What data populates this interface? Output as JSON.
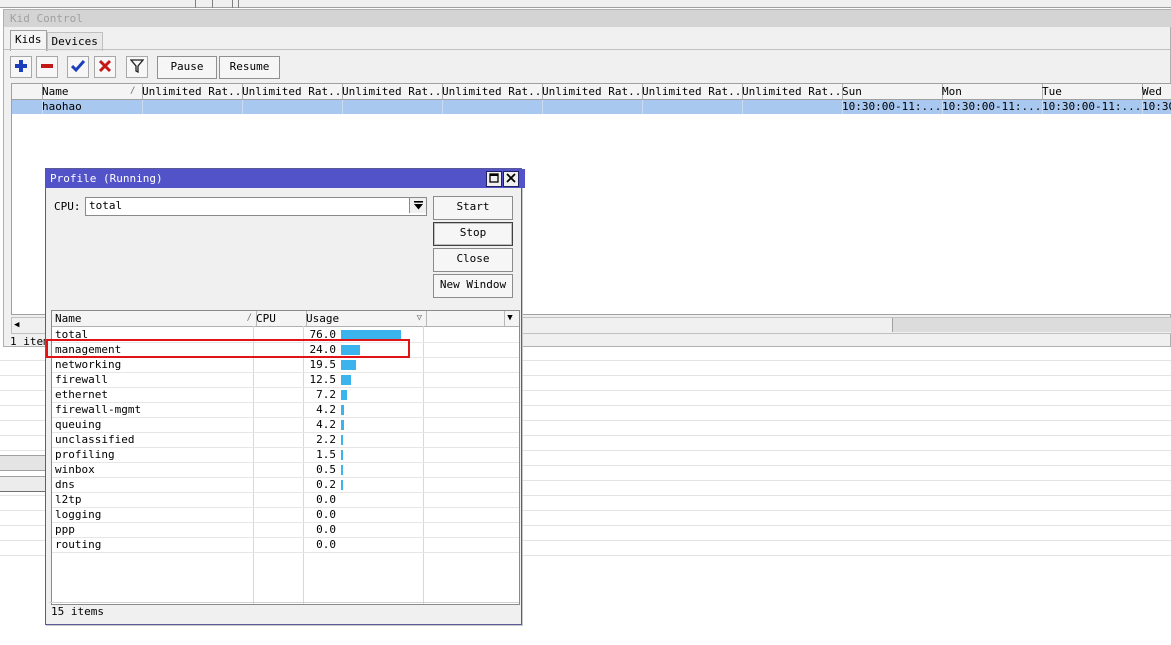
{
  "kid_control": {
    "title": "Kid Control",
    "tabs": [
      "Kids",
      "Devices"
    ],
    "toolbar": {
      "add_icon": "plus-icon",
      "remove_icon": "minus-icon",
      "enable_icon": "check-icon",
      "disable_icon": "x-icon",
      "filter_icon": "filter-icon",
      "pause_label": "Pause",
      "resume_label": "Resume"
    },
    "columns": [
      "Name",
      "Unlimited Rat...",
      "Unlimited Rat...",
      "Unlimited Rat...",
      "Unlimited Rat...",
      "Unlimited Rat...",
      "Unlimited Rat...",
      "Unlimited Rat...",
      "Sun",
      "Mon",
      "Tue",
      "Wed"
    ],
    "row": [
      "haohao",
      "",
      "",
      "",
      "",
      "",
      "",
      "",
      "10:30:00-11:...",
      "10:30:00-11:...",
      "10:30:00-11:...",
      "10:30"
    ],
    "status": "1 item"
  },
  "profile": {
    "title": "Profile (Running)",
    "cpu_label": "CPU:",
    "cpu_value": "total",
    "buttons": {
      "start": "Start",
      "stop": "Stop",
      "close": "Close",
      "new_window": "New Window"
    },
    "columns": {
      "name": "Name",
      "cpu": "CPU",
      "usage": "Usage"
    },
    "rows": [
      {
        "name": "total",
        "usage": "76.0"
      },
      {
        "name": "management",
        "usage": "24.0"
      },
      {
        "name": "networking",
        "usage": "19.5"
      },
      {
        "name": "firewall",
        "usage": "12.5"
      },
      {
        "name": "ethernet",
        "usage": "7.2"
      },
      {
        "name": "firewall-mgmt",
        "usage": "4.2"
      },
      {
        "name": "queuing",
        "usage": "4.2"
      },
      {
        "name": "unclassified",
        "usage": "2.2"
      },
      {
        "name": "profiling",
        "usage": "1.5"
      },
      {
        "name": "winbox",
        "usage": "0.5"
      },
      {
        "name": "dns",
        "usage": "0.2"
      },
      {
        "name": "l2tp",
        "usage": "0.0"
      },
      {
        "name": "logging",
        "usage": "0.0"
      },
      {
        "name": "ppp",
        "usage": "0.0"
      },
      {
        "name": "routing",
        "usage": "0.0"
      }
    ],
    "status": "15 items",
    "bar_color": "#3bb3ec",
    "highlight_color": "#e01414",
    "highlighted_row": "management"
  }
}
